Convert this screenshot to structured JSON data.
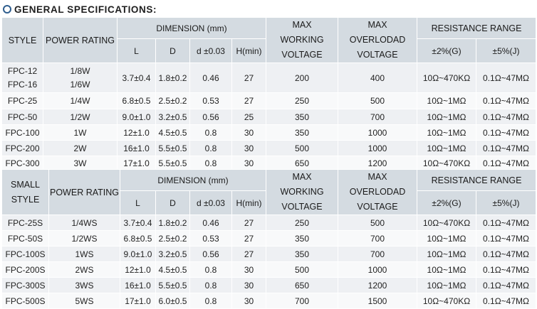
{
  "heading": "GENERAL SPECIFICATIONS:",
  "table1": {
    "header": {
      "style": "STYLE",
      "power": "POWER RATING",
      "dimension": "DIMENSION (mm)",
      "L": "L",
      "D": "D",
      "d": "d ±0.03",
      "H": "H(min)",
      "mwv": "MAX WORKING VOLTAGE",
      "mov": "MAX OVERLODAD VOLTAGE",
      "rr": "RESISTANCE RANGE",
      "r2": "±2%(G)",
      "r5": "±5%(J)"
    },
    "rows": [
      {
        "style": [
          "FPC-12",
          "FPC-16"
        ],
        "power": [
          "1/8W",
          "1/6W"
        ],
        "L": "3.7±0.4",
        "D": "1.8±0.2",
        "d": "0.46",
        "H": "27",
        "mwv": "200",
        "mov": "400",
        "r2": "10Ω~470KΩ",
        "r5": "0.1Ω~47MΩ"
      },
      {
        "style": [
          "FPC-25"
        ],
        "power": [
          "1/4W"
        ],
        "L": "6.8±0.5",
        "D": "2.5±0.2",
        "d": "0.53",
        "H": "27",
        "mwv": "250",
        "mov": "500",
        "r2": "10Ω~1MΩ",
        "r5": "0.1Ω~47MΩ"
      },
      {
        "style": [
          "FPC-50"
        ],
        "power": [
          "1/2W"
        ],
        "L": "9.0±1.0",
        "D": "3.2±0.5",
        "d": "0.56",
        "H": "25",
        "mwv": "350",
        "mov": "700",
        "r2": "10Ω~1MΩ",
        "r5": "0.1Ω~47MΩ"
      },
      {
        "style": [
          "FPC-100"
        ],
        "power": [
          "1W"
        ],
        "L": "12±1.0",
        "D": "4.5±0.5",
        "d": "0.8",
        "H": "30",
        "mwv": "350",
        "mov": "1000",
        "r2": "10Ω~1MΩ",
        "r5": "0.1Ω~47MΩ"
      },
      {
        "style": [
          "FPC-200"
        ],
        "power": [
          "2W"
        ],
        "L": "16±1.0",
        "D": "5.5±0.5",
        "d": "0.8",
        "H": "30",
        "mwv": "500",
        "mov": "1000",
        "r2": "10Ω~1MΩ",
        "r5": "0.1Ω~47MΩ"
      },
      {
        "style": [
          "FPC-300"
        ],
        "power": [
          "3W"
        ],
        "L": "17±1.0",
        "D": "5.5±0.5",
        "d": "0.8",
        "H": "30",
        "mwv": "650",
        "mov": "1200",
        "r2": "10Ω~470KΩ",
        "r5": "0.1Ω~47MΩ"
      }
    ]
  },
  "table2": {
    "header": {
      "style": [
        "SMALL",
        "STYLE"
      ],
      "power": "POWER RATING",
      "dimension": "DIMENSION (mm)",
      "L": "L",
      "D": "D",
      "d": "d ±0.03",
      "H": "H(min)",
      "mwv": "MAX WORKING VOLTAGE",
      "mov": "MAX OVERLODAD VOLTAGE",
      "rr": "RESISTANCE RANGE",
      "r2": "±2%(G)",
      "r5": "±5%(J)"
    },
    "rows": [
      {
        "style": "FPC-25S",
        "power": "1/4WS",
        "L": "3.7±0.4",
        "D": "1.8±0.2",
        "d": "0.46",
        "H": "27",
        "mwv": "250",
        "mov": "500",
        "r2": "10Ω~470KΩ",
        "r5": "0.1Ω~47MΩ"
      },
      {
        "style": "FPC-50S",
        "power": "1/2WS",
        "L": "6.8±0.5",
        "D": "2.5±0.2",
        "d": "0.53",
        "H": "27",
        "mwv": "350",
        "mov": "700",
        "r2": "10Ω~1MΩ",
        "r5": "0.1Ω~47MΩ"
      },
      {
        "style": "FPC-100S",
        "power": "1WS",
        "L": "9.0±1.0",
        "D": "3.2±0.5",
        "d": "0.56",
        "H": "27",
        "mwv": "350",
        "mov": "700",
        "r2": "10Ω~1MΩ",
        "r5": "0.1Ω~47MΩ"
      },
      {
        "style": "FPC-200S",
        "power": "2WS",
        "L": "12±1.0",
        "D": "4.5±0.5",
        "d": "0.8",
        "H": "30",
        "mwv": "500",
        "mov": "1000",
        "r2": "10Ω~1MΩ",
        "r5": "0.1Ω~47MΩ"
      },
      {
        "style": "FPC-300S",
        "power": "3WS",
        "L": "16±1.0",
        "D": "5.5±0.5",
        "d": "0.8",
        "H": "30",
        "mwv": "650",
        "mov": "1200",
        "r2": "10Ω~1MΩ",
        "r5": "0.1Ω~47MΩ"
      },
      {
        "style": "FPC-500S",
        "power": "5WS",
        "L": "17±1.0",
        "D": "6.0±0.5",
        "d": "0.8",
        "H": "30",
        "mwv": "700",
        "mov": "1500",
        "r2": "10Ω~470KΩ",
        "r5": "0.1Ω~47MΩ"
      }
    ]
  }
}
